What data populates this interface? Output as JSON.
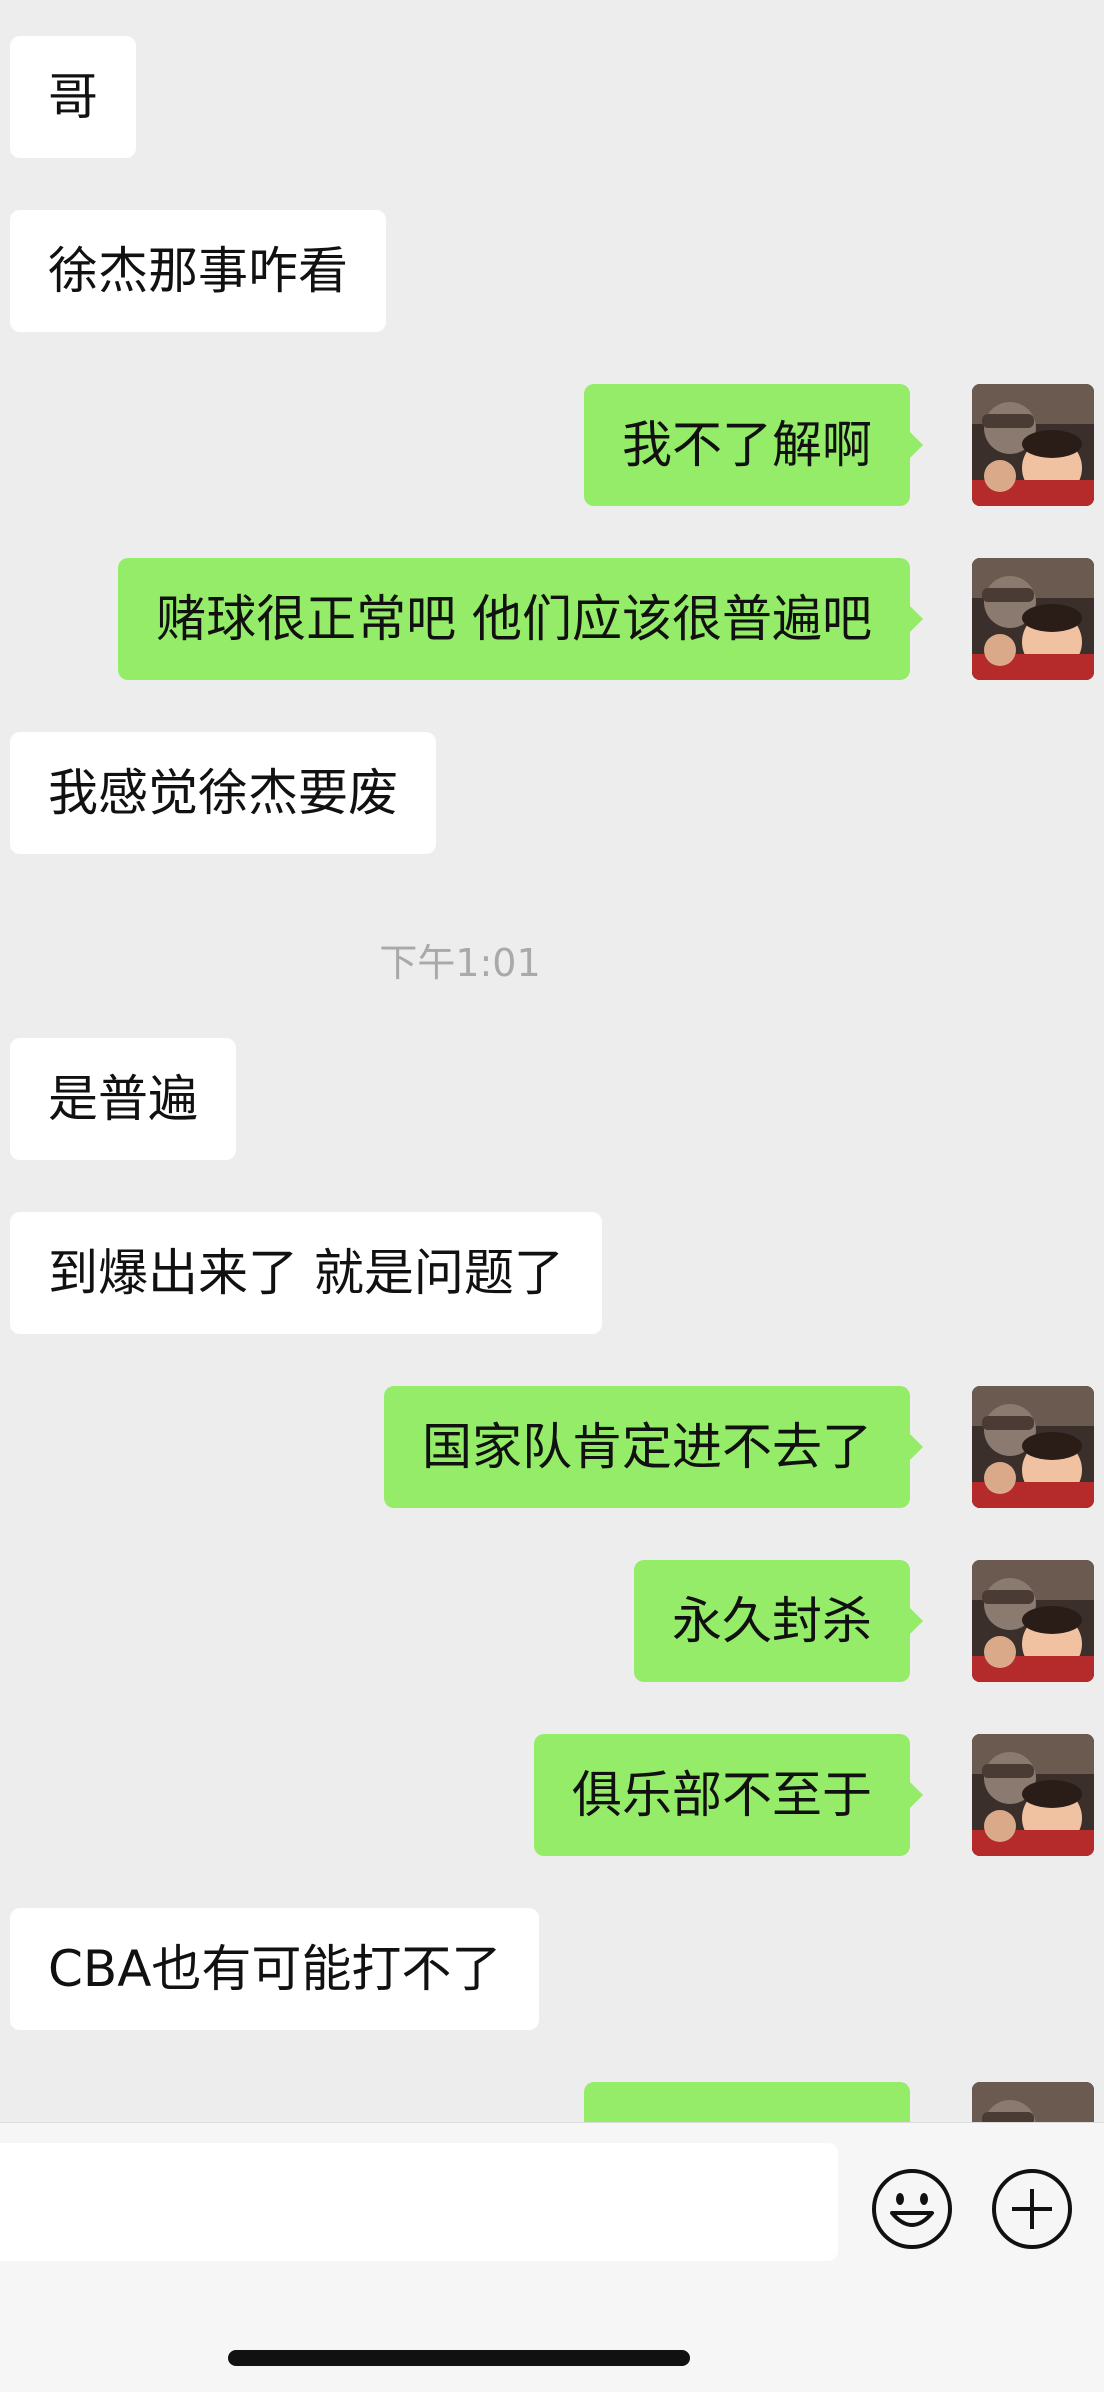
{
  "chat": {
    "messages": [
      {
        "side": "in",
        "text": "哥"
      },
      {
        "side": "in",
        "text": "徐杰那事咋看"
      },
      {
        "side": "out",
        "text": "我不了解啊"
      },
      {
        "side": "out",
        "text": "赌球很正常吧 他们应该很普遍吧"
      },
      {
        "side": "in",
        "text": "我感觉徐杰要废"
      },
      {
        "side": "time",
        "text": "下午1:01"
      },
      {
        "side": "in",
        "text": "是普遍"
      },
      {
        "side": "in",
        "text": "到爆出来了 就是问题了"
      },
      {
        "side": "out",
        "text": "国家队肯定进不去了"
      },
      {
        "side": "out",
        "text": "永久封杀"
      },
      {
        "side": "out",
        "text": "俱乐部不至于"
      },
      {
        "side": "in",
        "text": "CBA也有可能打不了"
      },
      {
        "side": "out",
        "text": ""
      }
    ]
  },
  "input_bar": {
    "icons": [
      "emoji-icon",
      "plus-icon"
    ]
  },
  "colors": {
    "background": "#ededed",
    "incoming_bubble": "#ffffff",
    "outgoing_bubble": "#95ec69"
  }
}
